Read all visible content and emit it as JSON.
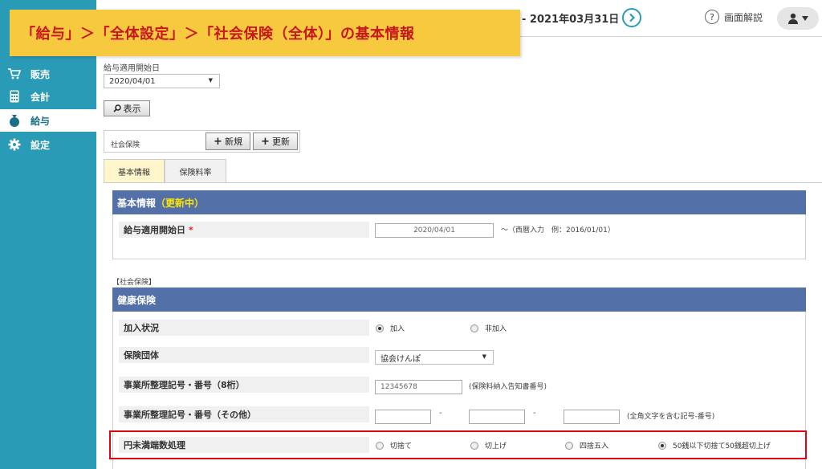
{
  "callout": {
    "text": "「給与」＞「全体設定」＞「社会保険（全体）」の基本情報"
  },
  "header": {
    "period": "- 2021年03月31日",
    "help_label": "画面解説",
    "help_mark": "?"
  },
  "sidebar": {
    "items": [
      {
        "label": "販売",
        "icon": "cart-icon"
      },
      {
        "label": "会計",
        "icon": "calculator-icon"
      },
      {
        "label": "給与",
        "icon": "money-bag-icon"
      },
      {
        "label": "設定",
        "icon": "gear-icon"
      }
    ]
  },
  "filter": {
    "label": "給与適用開始日",
    "selected": "2020/04/01",
    "show_button": "表示"
  },
  "master": {
    "label": "社会保険",
    "new_button": "新規",
    "update_button": "更新"
  },
  "tabs": [
    {
      "label": "基本情報",
      "active": true
    },
    {
      "label": "保険料率",
      "active": false
    }
  ],
  "basic_section": {
    "title": "基本情報",
    "status": "（更新中）",
    "start_date_label": "給与適用開始日",
    "required_mark": "*",
    "start_date_value": "2020/04/01",
    "start_date_note": "～（西暦入力　例：2016/01/01）"
  },
  "social_insurance_label": "【社会保険】",
  "health_section": {
    "title": "健康保険",
    "enrollment_label": "加入状況",
    "enrollment_options": [
      "加入",
      "非加入"
    ],
    "enrollment_selected": "加入",
    "insurer_label": "保険団体",
    "insurer_value": "協会けんぽ",
    "office_code8_label": "事業所整理記号・番号（8桁）",
    "office_code8_value": "12345678",
    "office_code8_note": "(保険料納入告知書番号)",
    "office_code_other_label": "事業所整理記号・番号（その他）",
    "office_code_other_note": "(全角文字を含む記号-番号)",
    "separator": "-",
    "rounding_label": "円未満端数処理",
    "rounding_options": [
      "切捨て",
      "切上げ",
      "四捨五入",
      "50銭以下切捨て50銭超切上げ"
    ],
    "rounding_selected": "50銭以下切捨て50銭超切上げ"
  },
  "colors": {
    "sidebar": "#2a9bb7",
    "section_header": "#5370a8",
    "callout_bg": "#f7c93e",
    "callout_text": "#c8171d",
    "highlight_border": "#e60012"
  }
}
